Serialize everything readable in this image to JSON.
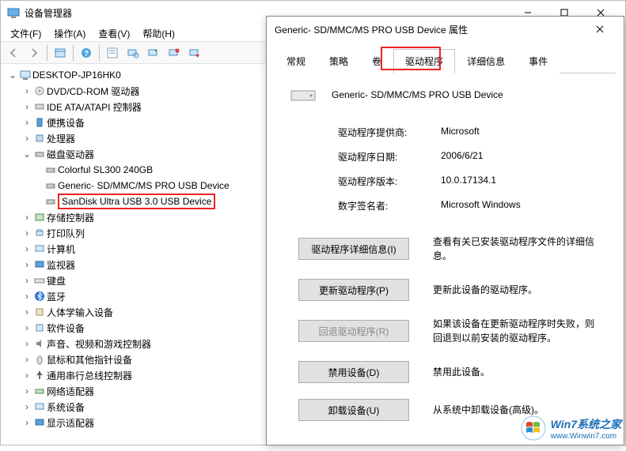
{
  "main": {
    "title": "设备管理器",
    "menu": [
      "文件(F)",
      "操作(A)",
      "查看(V)",
      "帮助(H)"
    ],
    "tree": {
      "root": "DESKTOP-JP16HK0",
      "items": [
        {
          "label": "DVD/CD-ROM 驱动器",
          "expanded": false
        },
        {
          "label": "IDE ATA/ATAPI 控制器",
          "expanded": false
        },
        {
          "label": "便携设备",
          "expanded": false
        },
        {
          "label": "处理器",
          "expanded": false
        },
        {
          "label": "磁盘驱动器",
          "expanded": true,
          "children": [
            "Colorful SL300 240GB",
            "Generic- SD/MMC/MS PRO USB Device",
            "SanDisk Ultra USB 3.0 USB Device"
          ]
        },
        {
          "label": "存储控制器",
          "expanded": false
        },
        {
          "label": "打印队列",
          "expanded": false
        },
        {
          "label": "计算机",
          "expanded": false
        },
        {
          "label": "监视器",
          "expanded": false
        },
        {
          "label": "键盘",
          "expanded": false
        },
        {
          "label": "蓝牙",
          "expanded": false
        },
        {
          "label": "人体学输入设备",
          "expanded": false
        },
        {
          "label": "软件设备",
          "expanded": false
        },
        {
          "label": "声音、视频和游戏控制器",
          "expanded": false
        },
        {
          "label": "鼠标和其他指针设备",
          "expanded": false
        },
        {
          "label": "通用串行总线控制器",
          "expanded": false
        },
        {
          "label": "网络适配器",
          "expanded": false
        },
        {
          "label": "系统设备",
          "expanded": false
        },
        {
          "label": "显示适配器",
          "expanded": false
        }
      ]
    }
  },
  "dialog": {
    "title": "Generic- SD/MMC/MS PRO USB Device 属性",
    "tabs": [
      "常规",
      "策略",
      "卷",
      "驱动程序",
      "详细信息",
      "事件"
    ],
    "active_tab": "驱动程序",
    "device_name": "Generic- SD/MMC/MS PRO USB Device",
    "info": {
      "provider_label": "驱动程序提供商:",
      "provider_value": "Microsoft",
      "date_label": "驱动程序日期:",
      "date_value": "2006/6/21",
      "version_label": "驱动程序版本:",
      "version_value": "10.0.17134.1",
      "signer_label": "数字签名者:",
      "signer_value": "Microsoft Windows"
    },
    "actions": {
      "details_btn": "驱动程序详细信息(I)",
      "details_desc": "查看有关已安装驱动程序文件的详细信息。",
      "update_btn": "更新驱动程序(P)",
      "update_desc": "更新此设备的驱动程序。",
      "rollback_btn": "回退驱动程序(R)",
      "rollback_desc": "如果该设备在更新驱动程序时失败，则回退到以前安装的驱动程序。",
      "disable_btn": "禁用设备(D)",
      "disable_desc": "禁用此设备。",
      "uninstall_btn": "卸载设备(U)",
      "uninstall_desc": "从系统中卸载设备(高级)。"
    }
  },
  "watermark": {
    "top": "Win7系统之家",
    "bottom": "www.Winwin7.com"
  }
}
